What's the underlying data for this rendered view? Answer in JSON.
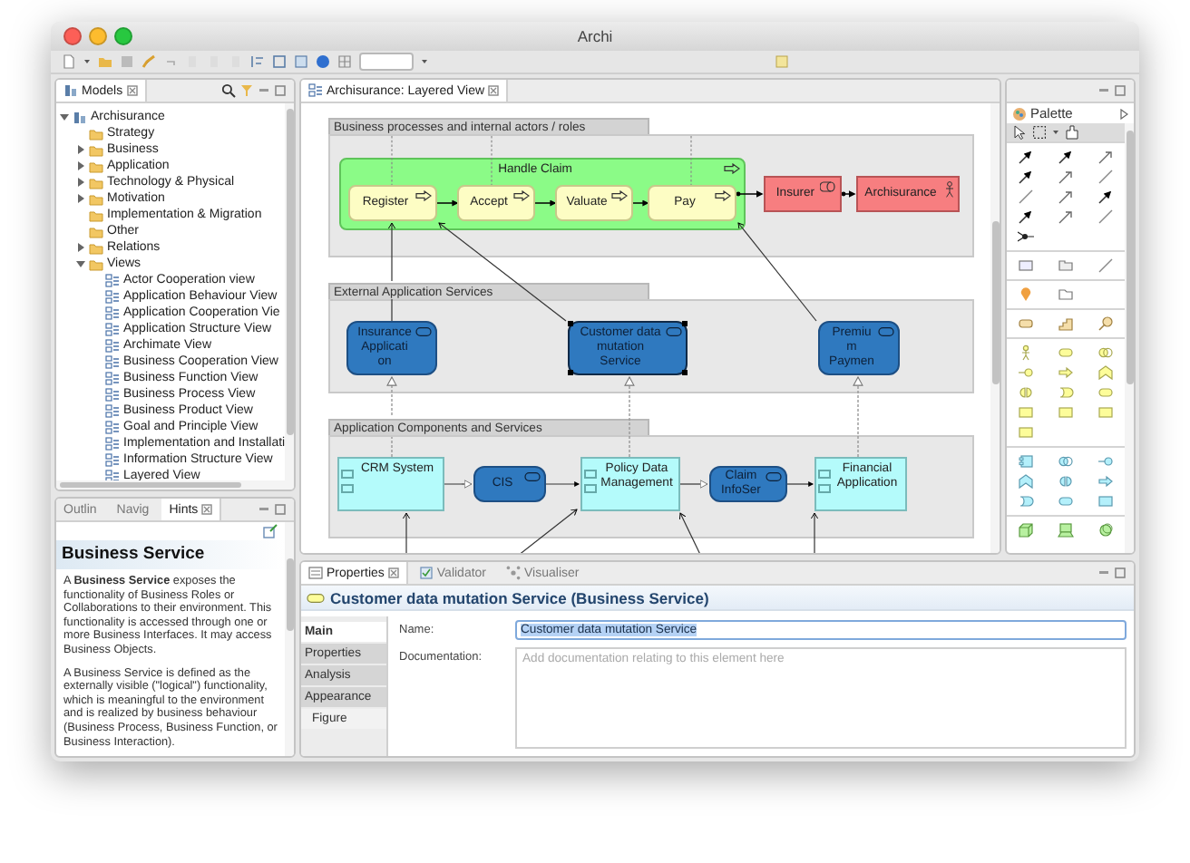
{
  "window": {
    "title": "Archi"
  },
  "models_panel": {
    "tab": "Models",
    "tree": [
      {
        "label": "Archisurance",
        "kind": "model",
        "expanded": true,
        "children": [
          {
            "label": "Strategy",
            "kind": "folder"
          },
          {
            "label": "Business",
            "kind": "folder",
            "expanded": false
          },
          {
            "label": "Application",
            "kind": "folder",
            "expanded": false
          },
          {
            "label": "Technology & Physical",
            "kind": "folder",
            "expanded": false
          },
          {
            "label": "Motivation",
            "kind": "folder",
            "expanded": false
          },
          {
            "label": "Implementation & Migration",
            "kind": "folder"
          },
          {
            "label": "Other",
            "kind": "folder"
          },
          {
            "label": "Relations",
            "kind": "folder",
            "expanded": false
          },
          {
            "label": "Views",
            "kind": "folder",
            "expanded": true,
            "children": [
              {
                "label": "Actor Cooperation view",
                "kind": "view"
              },
              {
                "label": "Application Behaviour View",
                "kind": "view"
              },
              {
                "label": "Application Cooperation Vie",
                "kind": "view"
              },
              {
                "label": "Application Structure View",
                "kind": "view"
              },
              {
                "label": "Archimate View",
                "kind": "view"
              },
              {
                "label": "Business Cooperation View",
                "kind": "view"
              },
              {
                "label": "Business Function View",
                "kind": "view"
              },
              {
                "label": "Business Process View",
                "kind": "view"
              },
              {
                "label": "Business Product View",
                "kind": "view"
              },
              {
                "label": "Goal and Principle View",
                "kind": "view"
              },
              {
                "label": "Implementation and Installati",
                "kind": "view"
              },
              {
                "label": "Information Structure View",
                "kind": "view"
              },
              {
                "label": "Layered View",
                "kind": "view"
              }
            ]
          }
        ]
      }
    ]
  },
  "hints_panel": {
    "tabs": [
      {
        "label": "Outlin",
        "selected": false
      },
      {
        "label": "Navig",
        "selected": false
      },
      {
        "label": "Hints",
        "selected": true
      }
    ],
    "title": "Business Service",
    "paragraphs": [
      "A **Business Service** exposes the functionality of Business Roles or Collaborations to their environment. This functionality is accessed through one or more Business Interfaces. It may access Business Objects.",
      "A Business Service is defined as the externally visible (\"logical\") functionality, which is meaningful to the environment and is realized by business behaviour (Business Process, Business Function, or Business Interaction)."
    ]
  },
  "editor": {
    "tab": "Archisurance: Layered View",
    "groups": [
      {
        "title": "Business processes and internal actors / roles"
      },
      {
        "title": "External Application Services"
      },
      {
        "title": "Application Components and Services"
      }
    ],
    "nodes": [
      {
        "label": "Handle Claim",
        "kind": "process_group",
        "selected": false
      },
      {
        "label": "Register",
        "kind": "process",
        "selected": false
      },
      {
        "label": "Accept",
        "kind": "process",
        "selected": false
      },
      {
        "label": "Valuate",
        "kind": "process",
        "selected": false
      },
      {
        "label": "Pay",
        "kind": "process",
        "selected": false
      },
      {
        "label": "Insurer",
        "kind": "role",
        "selected": false
      },
      {
        "label": "Archisurance",
        "kind": "actor",
        "selected": false
      },
      {
        "label": "Insurance\nApplicati\non",
        "kind": "service",
        "selected": false
      },
      {
        "label": "Customer data\nmutation\nService",
        "kind": "service",
        "selected": true
      },
      {
        "label": "Premiu\nm\nPaymen",
        "kind": "service",
        "selected": false
      },
      {
        "label": "CRM System",
        "kind": "component",
        "selected": false
      },
      {
        "label": "CIS",
        "kind": "service",
        "selected": false
      },
      {
        "label": "Policy Data\nManagement",
        "kind": "component",
        "selected": false
      },
      {
        "label": "Claim\nInfoSer",
        "kind": "service",
        "selected": false
      },
      {
        "label": "Financial\nApplication",
        "kind": "component",
        "selected": false
      }
    ]
  },
  "palette": {
    "title": "Palette"
  },
  "properties": {
    "tabs": [
      {
        "label": "Properties",
        "selected": true
      },
      {
        "label": "Validator",
        "selected": false
      },
      {
        "label": "Visualiser",
        "selected": false
      }
    ],
    "title": "Customer data mutation Service (Business Service)",
    "sections": [
      {
        "label": "Main",
        "kind": "section",
        "selected": true
      },
      {
        "label": "Properties",
        "kind": "section",
        "selected": false
      },
      {
        "label": "Analysis",
        "kind": "section",
        "selected": false
      },
      {
        "label": "Appearance",
        "kind": "section",
        "selected": false
      },
      {
        "label": "Figure",
        "kind": "subsection",
        "selected": false
      }
    ],
    "name_label": "Name:",
    "name_value": "Customer data mutation Service",
    "documentation_label": "Documentation:",
    "documentation_placeholder": "Add documentation relating to this element here"
  }
}
